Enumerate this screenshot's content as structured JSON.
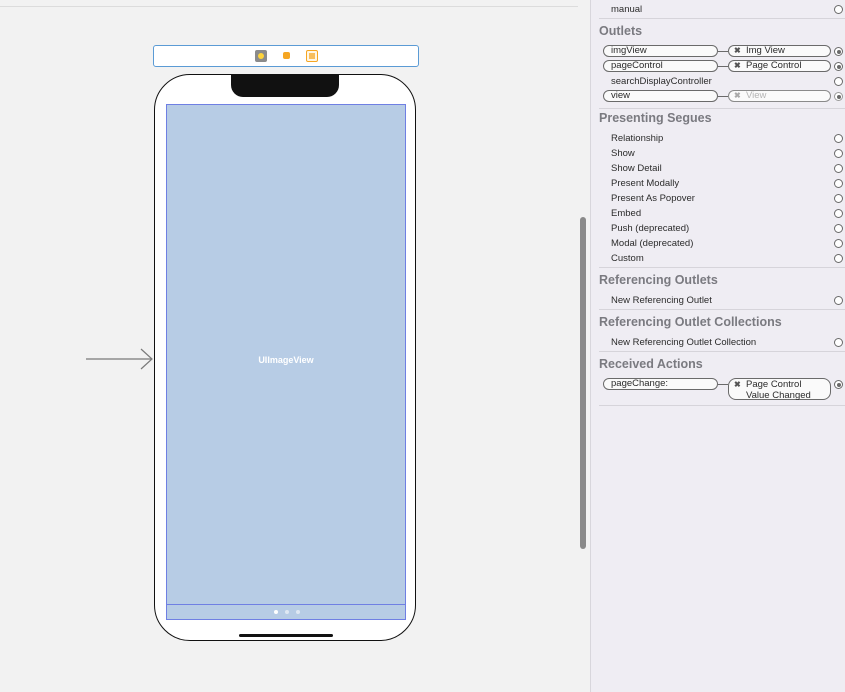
{
  "canvas": {
    "image_view_label": "UIImageView",
    "page_control_dots": 3,
    "page_control_active_index": 0
  },
  "inspector": {
    "top_item": "manual",
    "outlets_title": "Outlets",
    "outlets": [
      {
        "name": "imgView",
        "target": "Img View",
        "connected": true,
        "dim": false
      },
      {
        "name": "pageControl",
        "target": "Page Control",
        "connected": true,
        "dim": false
      },
      {
        "name": "searchDisplayController",
        "target": "",
        "connected": false,
        "dim": false
      },
      {
        "name": "view",
        "target": "View",
        "connected": true,
        "dim": true
      }
    ],
    "segues_title": "Presenting Segues",
    "segues": [
      "Relationship",
      "Show",
      "Show Detail",
      "Present Modally",
      "Present As Popover",
      "Embed",
      "Push (deprecated)",
      "Modal (deprecated)",
      "Custom"
    ],
    "ref_outlets_title": "Referencing Outlets",
    "ref_outlets_item": "New Referencing Outlet",
    "ref_collections_title": "Referencing Outlet Collections",
    "ref_collections_item": "New Referencing Outlet Collection",
    "actions_title": "Received Actions",
    "action": {
      "name": "pageChange:",
      "target_line1": "Page Control",
      "target_line2": "Value Changed"
    }
  }
}
